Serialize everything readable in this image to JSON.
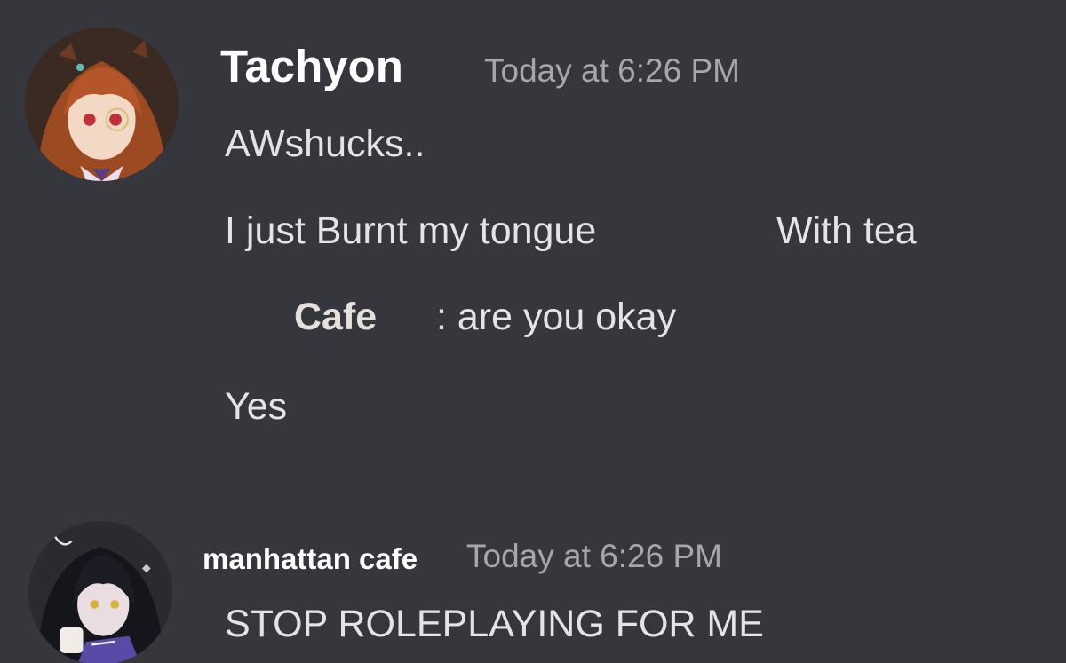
{
  "messages": [
    {
      "author": "Tachyon",
      "timestamp": "Today at 6:26 PM",
      "avatar_icon": "anime-avatar-brown-hair",
      "lines": {
        "l1": "AWshucks..",
        "l2a": "I  just Burnt my tongue",
        "l2b": "With tea",
        "l3_name": "Cafe",
        "l3_text": ": are you okay",
        "l4": "Yes"
      }
    },
    {
      "author": "manhattan cafe",
      "timestamp": "Today at 6:26 PM",
      "avatar_icon": "anime-avatar-black-hair",
      "lines": {
        "l1": "STOP ROLEPLAYING FOR ME"
      }
    }
  ],
  "colors": {
    "background": "#36373d",
    "username": "#ffffff",
    "timestamp": "#a4a7ad",
    "message_text": "#e2e4e8"
  }
}
